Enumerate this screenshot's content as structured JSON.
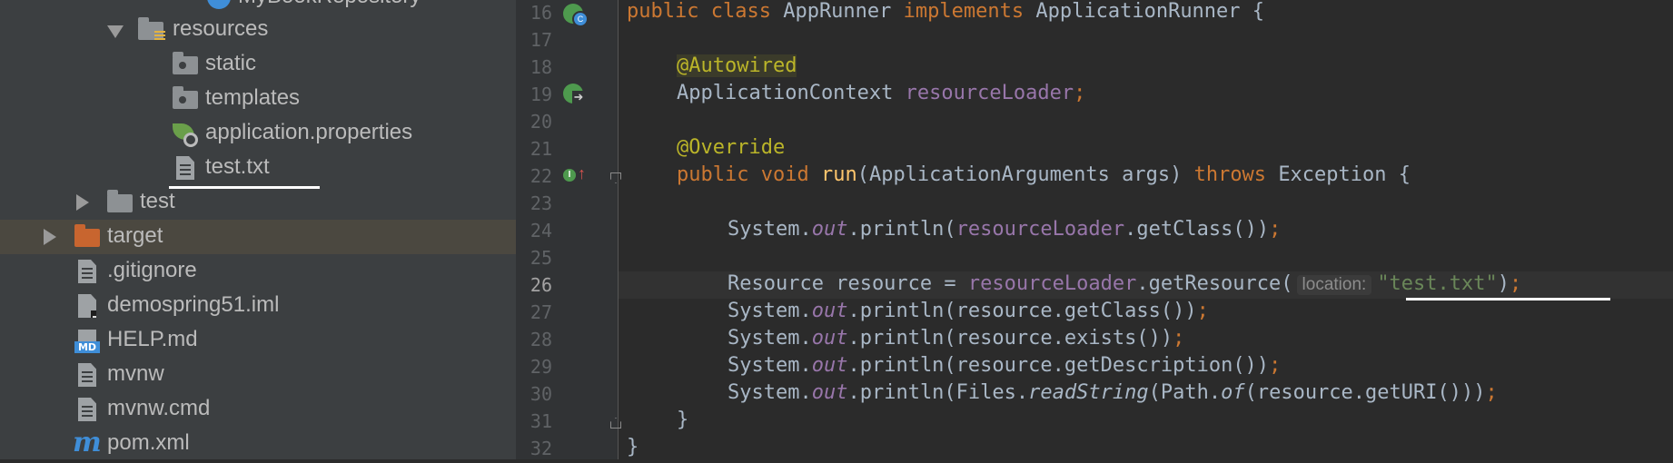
{
  "tree": {
    "partial_item": "MyBookRepository",
    "items": [
      {
        "label": "resources"
      },
      {
        "label": "static"
      },
      {
        "label": "templates"
      },
      {
        "label": "application.properties"
      },
      {
        "label": "test.txt"
      },
      {
        "label": "test"
      },
      {
        "label": "target"
      },
      {
        "label": ".gitignore"
      },
      {
        "label": "demospring51.iml"
      },
      {
        "label": "HELP.md"
      },
      {
        "label": "mvnw"
      },
      {
        "label": "mvnw.cmd"
      },
      {
        "label": "pom.xml"
      }
    ],
    "md_badge": "MD",
    "maven_m": "m"
  },
  "editor": {
    "line_numbers": [
      "16",
      "17",
      "18",
      "19",
      "20",
      "21",
      "22",
      "23",
      "24",
      "25",
      "26",
      "27",
      "28",
      "29",
      "30",
      "31",
      "32"
    ],
    "current_line": "26",
    "gutter_badges": {
      "c": "C",
      "arrow": "➜",
      "impl": "I",
      "up": "↑"
    },
    "code": {
      "l16": {
        "kw1": "public class",
        "name": "AppRunner",
        "kw2": "implements",
        "iface": "ApplicationRunner {"
      },
      "l18": {
        "ann": "@Autowired"
      },
      "l19": {
        "type": "ApplicationContext",
        "field": "resourceLoader",
        "semi": ";"
      },
      "l21": {
        "ann": "@Override"
      },
      "l22": {
        "kw1": "public void",
        "method": "run",
        "params": "(ApplicationArguments args)",
        "kw2": "throws",
        "rest": "Exception {"
      },
      "l24": {
        "a": "System.",
        "out": "out",
        "b": ".println(",
        "field": "resourceLoader",
        "c": ".getClass())",
        "semi": ";"
      },
      "l26": {
        "a": "Resource resource = ",
        "field": "resourceLoader",
        "b": ".getResource(",
        "hint": "location:",
        "str": "\"test.txt\"",
        "c": ")",
        "semi": ";"
      },
      "l27": {
        "a": "System.",
        "out": "out",
        "b": ".println(resource.getClass())",
        "semi": ";"
      },
      "l28": {
        "a": "System.",
        "out": "out",
        "b": ".println(resource.exists())",
        "semi": ";"
      },
      "l29": {
        "a": "System.",
        "out": "out",
        "b": ".println(resource.getDescription())",
        "semi": ";"
      },
      "l30": {
        "a": "System.",
        "out": "out",
        "b": ".println(Files.",
        "m1": "readString",
        "c": "(Path.",
        "m2": "of",
        "d": "(resource.getURI()))",
        "semi": ";"
      },
      "l31": {
        "brace": "}"
      },
      "l32": {
        "brace": "}"
      }
    }
  },
  "colors": {
    "keyword": "#cc7832",
    "annotation": "#bbb529",
    "field": "#9876aa",
    "method": "#ffc66d",
    "string": "#6a8759",
    "text": "#a9b7c6",
    "tree_bg": "#3c3f41",
    "editor_bg": "#2b2b2b",
    "selected_row": "#4b4840"
  }
}
